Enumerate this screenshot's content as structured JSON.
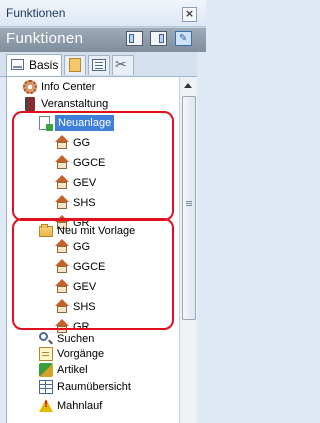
{
  "window": {
    "title": "Funktionen",
    "close_glyph": "×"
  },
  "header": {
    "title": "Funktionen"
  },
  "tabs": [
    {
      "label": "Basis",
      "icon": "basis-icon",
      "active": true
    },
    {
      "label": "",
      "icon": "documents-icon",
      "active": false
    },
    {
      "label": "",
      "icon": "list-icon",
      "active": false
    },
    {
      "label": "",
      "icon": "tools-icon",
      "active": false
    }
  ],
  "tree": {
    "info_center": "Info Center",
    "veranstaltung": "Veranstaltung",
    "neuanlage": "Neuanlage",
    "neuanlage_items": [
      "GG",
      "GGCE",
      "GEV",
      "SHS",
      "GR"
    ],
    "neu_mit_vorlage": "Neu mit Vorlage",
    "vorlage_items": [
      "GG",
      "GGCE",
      "GEV",
      "SHS",
      "GR"
    ],
    "suchen": "Suchen",
    "vorgaenge": "Vorgänge",
    "artikel": "Artikel",
    "raumuebersicht": "Raumübersicht",
    "mahnlauf": "Mahnlauf"
  },
  "colors": {
    "highlight_box": "#e0101e",
    "selection": "#3d7fd9",
    "header_band": "#8a98a8"
  }
}
